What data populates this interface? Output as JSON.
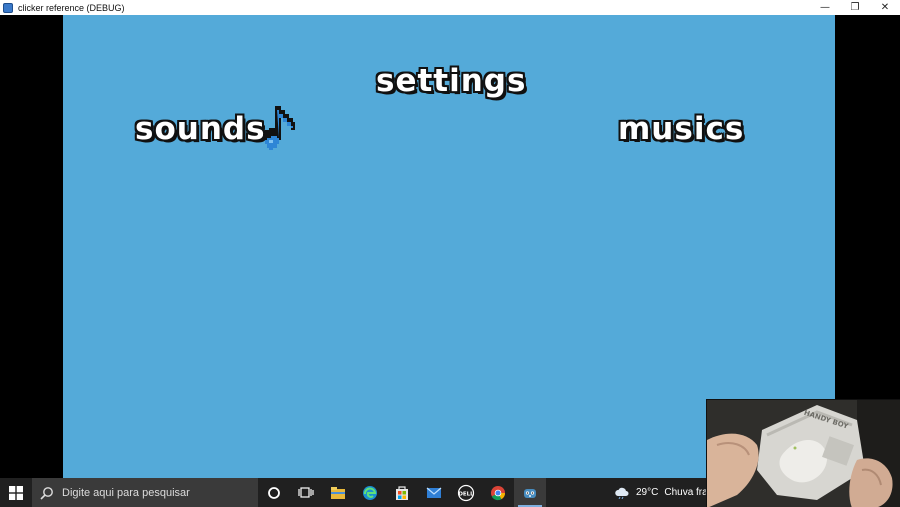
{
  "window": {
    "title": "clicker reference (DEBUG)",
    "controls": {
      "minimize": "—",
      "restore": "❐",
      "close": "✕"
    }
  },
  "game": {
    "title": "settings",
    "sounds_label": "sounds",
    "musics_label": "musics",
    "background_color": "#54aad9",
    "note_color": "#2e86d6"
  },
  "taskbar": {
    "search_placeholder": "Digite aqui para pesquisar",
    "pinned": [
      "cortana-icon",
      "task-view-icon",
      "file-explorer-icon",
      "edge-icon",
      "store-icon",
      "mail-icon",
      "dell-icon",
      "chrome-icon",
      "godot-icon"
    ],
    "dell_label": "DELL",
    "weather": {
      "temperature": "29°C",
      "condition": "Chuva fraca"
    }
  },
  "webcam": {
    "device_label_1": "HANDY BOY"
  }
}
